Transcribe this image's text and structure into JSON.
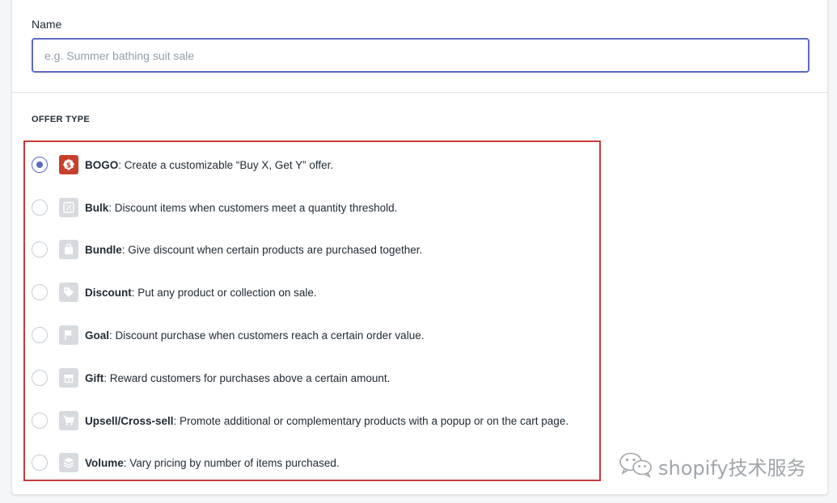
{
  "name_section": {
    "label": "Name",
    "placeholder": "e.g. Summer bathing suit sale",
    "value": ""
  },
  "offer_type": {
    "heading": "OFFER TYPE",
    "options": [
      {
        "title": "BOGO",
        "description": ": Create a customizable “Buy X, Get Y” offer.",
        "icon": "dollar-badge-icon",
        "selected": true
      },
      {
        "title": "Bulk",
        "description": ": Discount items when customers meet a quantity threshold.",
        "icon": "percent-icon",
        "selected": false
      },
      {
        "title": "Bundle",
        "description": ": Give discount when certain products are purchased together.",
        "icon": "shopping-bag-icon",
        "selected": false
      },
      {
        "title": "Discount",
        "description": ": Put any product or collection on sale.",
        "icon": "price-tag-icon",
        "selected": false
      },
      {
        "title": "Goal",
        "description": ": Discount purchase when customers reach a certain order value.",
        "icon": "flag-icon",
        "selected": false
      },
      {
        "title": "Gift",
        "description": ": Reward customers for purchases above a certain amount.",
        "icon": "gift-box-icon",
        "selected": false
      },
      {
        "title": "Upsell/Cross-sell",
        "description": ": Promote additional or complementary products with a popup or on the cart page.",
        "icon": "cart-icon",
        "selected": false
      },
      {
        "title": "Volume",
        "description": ": Vary pricing by number of items purchased.",
        "icon": "layers-icon",
        "selected": false
      }
    ]
  },
  "watermark": {
    "text": "shopify技术服务",
    "icon": "wechat-icon"
  },
  "colors": {
    "accent": "#5c6ac4",
    "highlight_border": "#c9383a",
    "active_icon": "#c6412d",
    "inactive_icon": "#d7dbdf"
  }
}
